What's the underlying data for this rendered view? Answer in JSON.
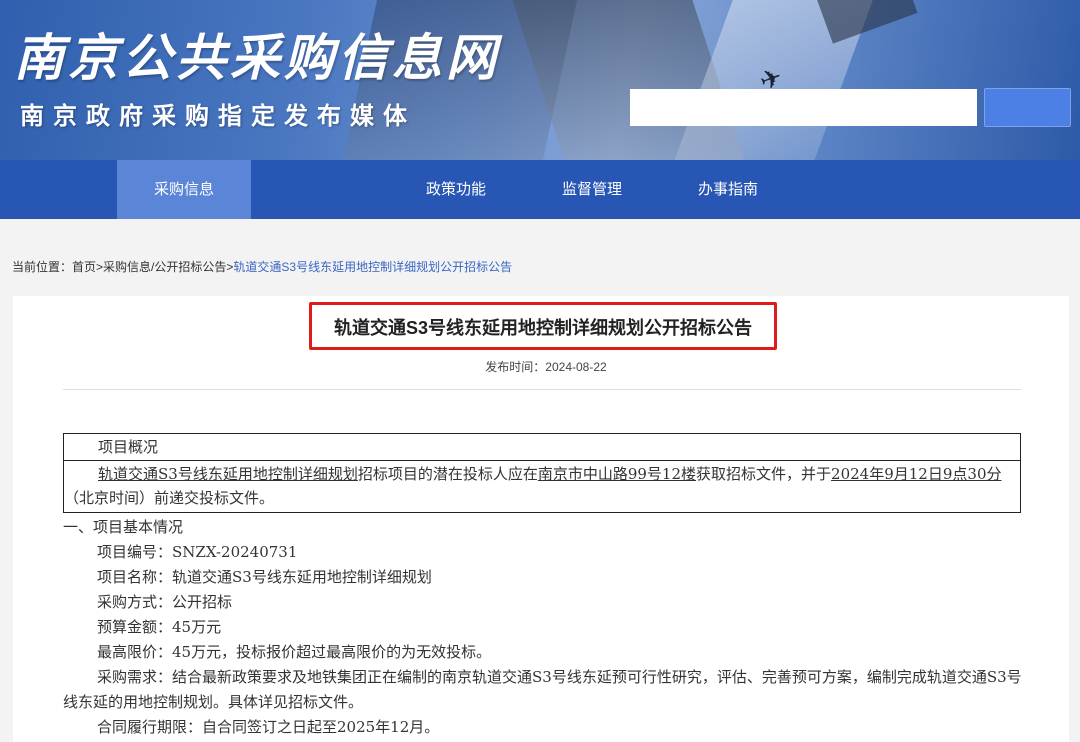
{
  "header": {
    "logo_title": "南京公共采购信息网",
    "logo_subtitle": "南京政府采购指定发布媒体",
    "search_placeholder": "",
    "search_button": ""
  },
  "nav": {
    "items": [
      {
        "label": "采购信息",
        "active": true
      },
      {
        "label": "政策功能",
        "active": false
      },
      {
        "label": "监督管理",
        "active": false
      },
      {
        "label": "办事指南",
        "active": false
      }
    ]
  },
  "breadcrumb": {
    "prefix": "当前位置：",
    "home": "首页",
    "sep1": ">",
    "section": "采购信息/公开招标公告",
    "sep2": ">",
    "current": "轨道交通S3号线东延用地控制详细规划公开招标公告"
  },
  "article": {
    "title": "轨道交通S3号线东延用地控制详细规划公开招标公告",
    "pubdate": "发布时间：2024-08-22",
    "overview": {
      "heading": "项目概况",
      "project_link": "轨道交通S3号线东延用地控制详细规划",
      "text1": "招标项目的潜在投标人应在",
      "address": "南京市中山路99号12楼",
      "text2": "获取招标文件，并于",
      "deadline": "2024年9月12日9点30分",
      "text3": "（北京时间）前递交投标文件。"
    },
    "section1": "一、项目基本情况",
    "project_no": "项目编号：SNZX-20240731",
    "project_name": "项目名称：轨道交通S3号线东延用地控制详细规划",
    "method": "采购方式：公开招标",
    "budget": "预算金额：45万元",
    "max_price": "最高限价：45万元，投标报价超过最高限价的为无效投标。",
    "demand": "采购需求：结合最新政策要求及地铁集团正在编制的南京轨道交通S3号线东延预可行性研究，评估、完善预可方案，编制完成轨道交通S3号线东延的用地控制规划。具体详见招标文件。",
    "contract_period": "合同履行期限：自合同签订之日起至2025年12月。"
  },
  "colors": {
    "nav_bg": "#2856b4",
    "nav_active": "#5b86d8",
    "highlight_box": "#e01919",
    "breadcrumb_current": "#3a66c4"
  }
}
